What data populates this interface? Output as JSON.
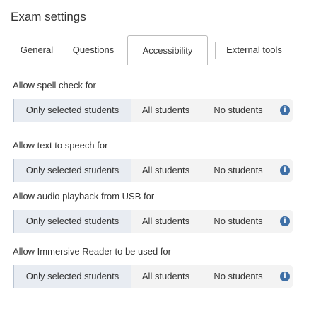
{
  "page_title": "Exam settings",
  "tabs": [
    {
      "label": "General"
    },
    {
      "label": "Questions"
    },
    {
      "label": "Accessibility"
    },
    {
      "label": "External tools"
    }
  ],
  "active_tab": "Accessibility",
  "settings": [
    {
      "label": "Allow spell check for",
      "options": [
        "Only selected students",
        "All students",
        "No students"
      ],
      "selected": "Only selected students"
    },
    {
      "label": "Allow text to speech for",
      "options": [
        "Only selected students",
        "All students",
        "No students"
      ],
      "selected": "Only selected students"
    },
    {
      "label": "Allow audio playback from USB for",
      "options": [
        "Only selected students",
        "All students",
        "No students"
      ],
      "selected": "Only selected students"
    },
    {
      "label": "Allow Immersive Reader to be used for",
      "options": [
        "Only selected students",
        "All students",
        "No students"
      ],
      "selected": "Only selected students"
    }
  ],
  "icons": {
    "info": "info-circle-icon"
  },
  "colors": {
    "info_icon": "#3e6fa6",
    "selected_segment": "#e8ecf2"
  }
}
